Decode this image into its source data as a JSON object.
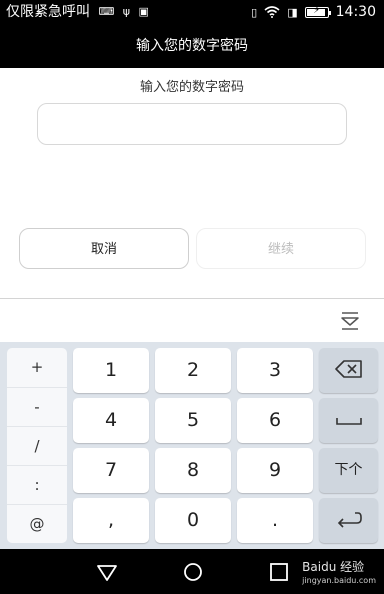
{
  "status_bar": {
    "left_text": "仅限紧急呼叫",
    "left_icons": [
      "keyboard-icon",
      "usb-icon",
      "image-icon"
    ],
    "right_icons": [
      "vibrate-icon",
      "wifi-icon",
      "sim-icon",
      "battery-charging-icon"
    ],
    "time": "14:30",
    "battery_level": 0.9
  },
  "title_bar": {
    "title": "输入您的数字密码"
  },
  "form": {
    "prompt": "输入您的数字密码",
    "pin_value": "",
    "pin_placeholder": ""
  },
  "actions": {
    "cancel_label": "取消",
    "continue_label": "继续"
  },
  "keyboard": {
    "symbols": [
      "+",
      "-",
      "/",
      ":",
      "@"
    ],
    "keys": [
      [
        "1",
        "2",
        "3"
      ],
      [
        "4",
        "5",
        "6"
      ],
      [
        "7",
        "8",
        "9"
      ],
      [
        ",",
        "0",
        "."
      ]
    ],
    "function_keys": {
      "backspace": "backspace-icon",
      "space": "space-icon",
      "next": "下个",
      "enter": "enter-icon"
    },
    "hide_icon": "keyboard-hide-icon"
  },
  "nav_bar": {
    "buttons": [
      "back-icon",
      "home-icon",
      "recents-icon"
    ],
    "watermark_main": "Baidu 经验",
    "watermark_sub": "jingyan.baidu.com"
  },
  "colors": {
    "bar_bg": "#000000",
    "keyboard_bg": "#dde3ea",
    "function_key_bg": "#cfd6de",
    "disabled_text": "#bdbdbd"
  }
}
